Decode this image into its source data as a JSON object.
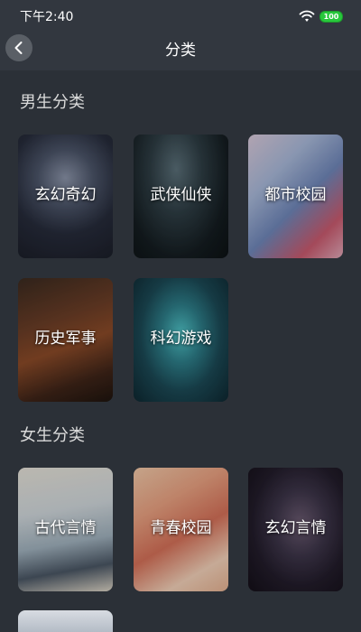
{
  "status_bar": {
    "time": "下午2:40",
    "battery": "100"
  },
  "nav": {
    "title": "分类"
  },
  "sections": [
    {
      "title": "男生分类",
      "items": [
        {
          "label": "玄幻奇幻"
        },
        {
          "label": "武侠仙侠"
        },
        {
          "label": "都市校园"
        },
        {
          "label": "历史军事"
        },
        {
          "label": "科幻游戏"
        }
      ]
    },
    {
      "title": "女生分类",
      "items": [
        {
          "label": "古代言情"
        },
        {
          "label": "青春校园"
        },
        {
          "label": "玄幻言情"
        }
      ]
    }
  ],
  "colors": {
    "background": "#2b3037",
    "bar": "#32373f",
    "battery": "#28c83c"
  }
}
